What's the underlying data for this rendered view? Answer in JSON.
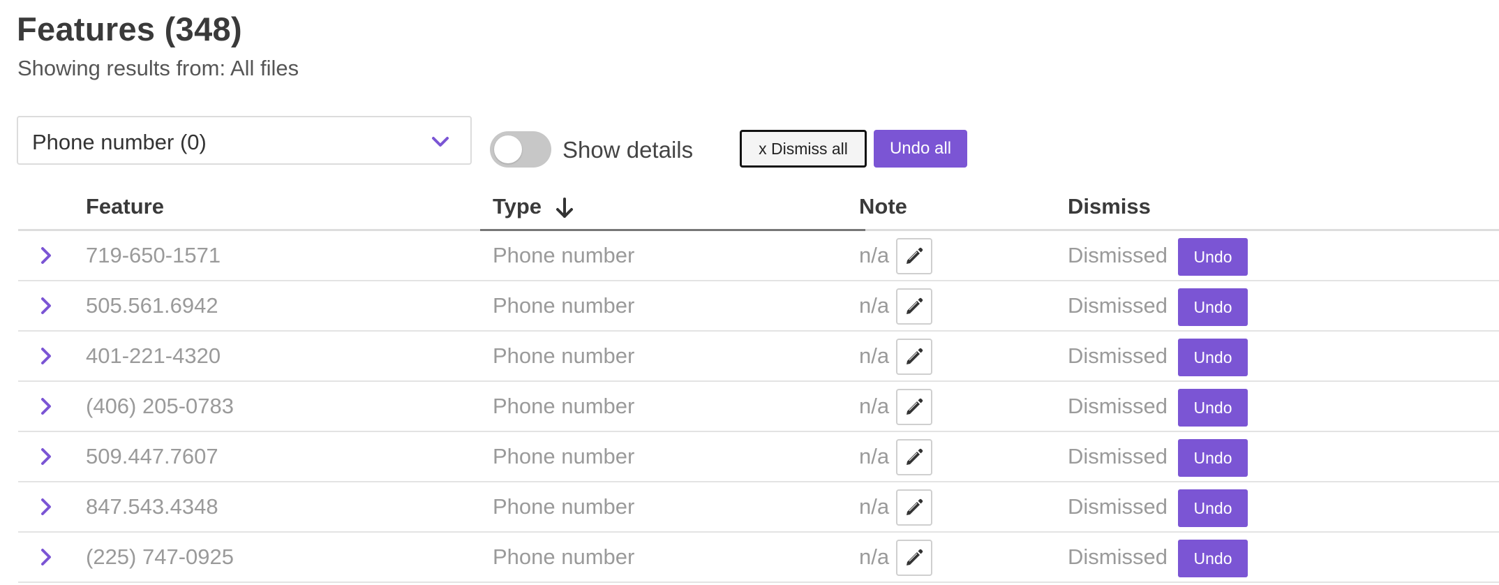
{
  "header": {
    "title": "Features (348)",
    "subtitle": "Showing results from: All files"
  },
  "filter": {
    "selected": "Phone number (0)",
    "icon": "chevron-down-icon"
  },
  "details_toggle": {
    "label": "Show details",
    "on": false
  },
  "actions": {
    "dismiss_all": "x Dismiss all",
    "undo_all": "Undo all"
  },
  "table": {
    "columns": {
      "feature": "Feature",
      "type": "Type",
      "note": "Note",
      "dismiss": "Dismiss"
    },
    "sorted_by": "Type",
    "sort_icon": "arrow-down-icon",
    "rows": [
      {
        "feature": "719-650-1571",
        "type": "Phone number",
        "note": "n/a",
        "status": "Dismissed",
        "action": "Undo"
      },
      {
        "feature": "505.561.6942",
        "type": "Phone number",
        "note": "n/a",
        "status": "Dismissed",
        "action": "Undo"
      },
      {
        "feature": "401-221-4320",
        "type": "Phone number",
        "note": "n/a",
        "status": "Dismissed",
        "action": "Undo"
      },
      {
        "feature": "(406) 205-0783",
        "type": "Phone number",
        "note": "n/a",
        "status": "Dismissed",
        "action": "Undo"
      },
      {
        "feature": "509.447.7607",
        "type": "Phone number",
        "note": "n/a",
        "status": "Dismissed",
        "action": "Undo"
      },
      {
        "feature": "847.543.4348",
        "type": "Phone number",
        "note": "n/a",
        "status": "Dismissed",
        "action": "Undo"
      },
      {
        "feature": "(225) 747-0925",
        "type": "Phone number",
        "note": "n/a",
        "status": "Dismissed",
        "action": "Undo"
      }
    ]
  },
  "colors": {
    "accent": "#7b55d4",
    "muted_text": "#9a9a9a",
    "border": "#dddddd"
  }
}
